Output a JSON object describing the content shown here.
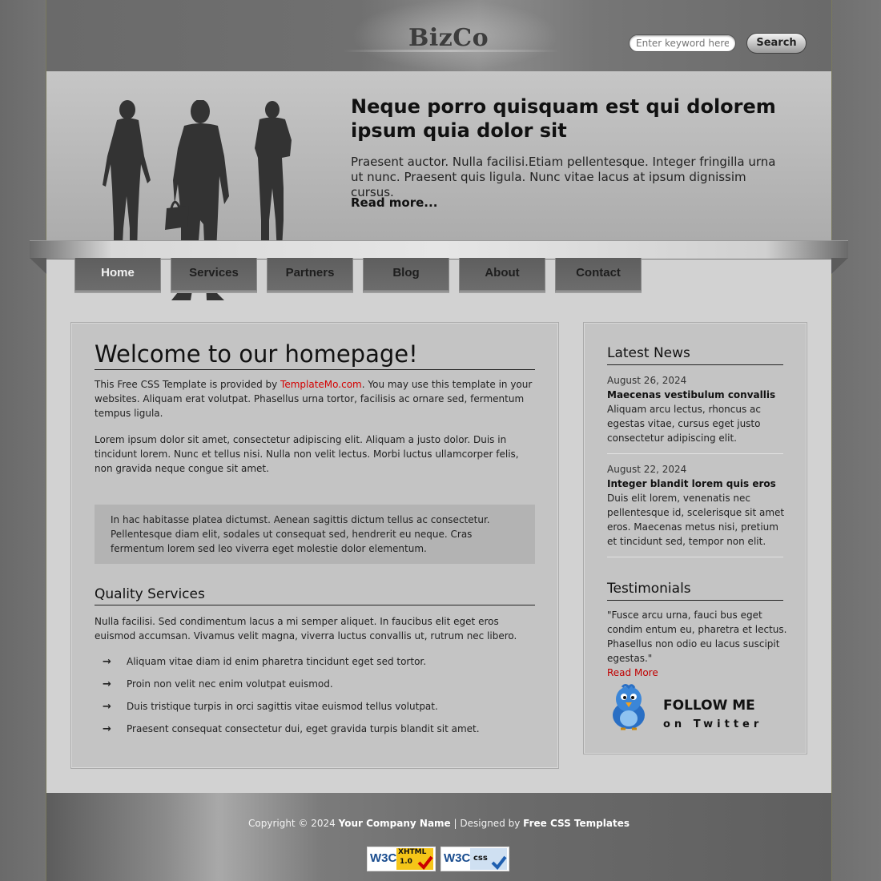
{
  "header": {
    "logo": "BizCo",
    "search_placeholder": "Enter keyword here...",
    "search_button": "Search"
  },
  "banner": {
    "title": "Neque porro quisquam est qui dolorem ipsum quia dolor sit",
    "text": "Praesent auctor. Nulla facilisi.Etiam pellentesque. Integer fringilla urna ut nunc. Praesent quis ligula. Nunc vitae lacus at ipsum dignissim cursus.",
    "read_more": "Read more..."
  },
  "nav": {
    "items": [
      {
        "label": "Home",
        "active": true
      },
      {
        "label": "Services"
      },
      {
        "label": "Partners"
      },
      {
        "label": "Blog"
      },
      {
        "label": "About"
      },
      {
        "label": "Contact"
      }
    ]
  },
  "main": {
    "title": "Welcome to our homepage!",
    "intro_before": "This Free CSS Template is provided by ",
    "intro_link": "TemplateMo.com",
    "intro_after": ". You may use this template in your websites. Aliquam erat volutpat. Phasellus urna tortor, facilisis ac ornare sed, fermentum tempus ligula.",
    "para2": "Lorem ipsum dolor sit amet, consectetur adipiscing elit. Aliquam a justo dolor. Duis in tincidunt lorem. Nunc et tellus nisi. Nulla non velit lectus. Morbi luctus ullamcorper felis, non gravida neque congue sit amet.",
    "quote": "In hac habitasse platea dictumst. Aenean sagittis dictum tellus ac consectetur. Pellentesque diam elit, sodales ut consequat sed, hendrerit eu neque. Cras fermentum lorem sed leo viverra eget molestie dolor elementum.",
    "services_title": "Quality Services",
    "services_text": "Nulla facilisi. Sed condimentum lacus a mi semper aliquet. In faucibus elit eget eros euismod accumsan. Vivamus velit magna, viverra luctus convallis ut, rutrum nec libero.",
    "list": [
      "Aliquam vitae diam id enim pharetra tincidunt eget sed tortor.",
      "Proin non velit nec enim volutpat euismod.",
      "Duis tristique turpis in orci sagittis vitae euismod tellus volutpat.",
      "Praesent consequat consectetur dui, eget gravida turpis blandit sit amet."
    ]
  },
  "sidebar": {
    "news_title": "Latest News",
    "news": [
      {
        "date": "August 26, 2024",
        "title": "Maecenas vestibulum convallis",
        "text": "Aliquam arcu lectus, rhoncus ac egestas vitae, cursus eget justo consectetur adipiscing elit."
      },
      {
        "date": "August 22, 2024",
        "title": "Integer blandit lorem quis eros",
        "text": "Duis elit lorem, venenatis nec pellentesque id, scelerisque sit amet eros. Maecenas metus nisi, pretium et tincidunt sed, tempor non elit."
      }
    ],
    "testimonials_title": "Testimonials",
    "testimonial": "\"Fusce arcu urna, fauci bus eget condim entum eu, pharetra et lectus. Phasellus non odio eu lacus suscipit egestas.\"",
    "testimonial_link": "Read More",
    "follow_line1": "FOLLOW ME",
    "follow_line2": "on Twitter"
  },
  "footer": {
    "copyright": "Copyright © 2024",
    "company": "Your Company Name",
    "designed_by": "| Designed by",
    "designer": "Free CSS Templates",
    "badge_xhtml_main": "W3C",
    "badge_xhtml_sub": "XHTML",
    "badge_xhtml_ver": "1.0",
    "badge_css_main": "W3C",
    "badge_css_sub": "css"
  }
}
